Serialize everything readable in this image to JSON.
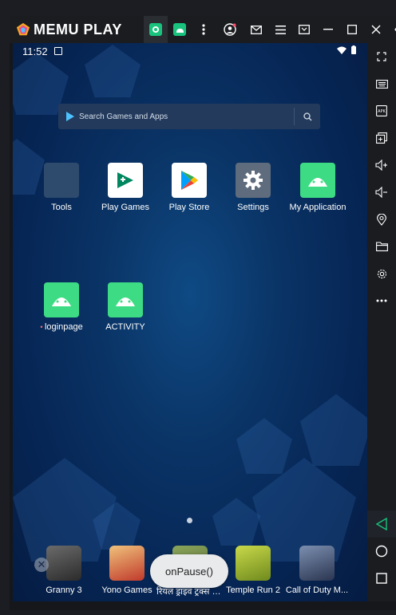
{
  "emulator": {
    "brand": "MEMU PLAY",
    "colors": {
      "accent": "#19c37d",
      "toolbar": "#1a1c20"
    },
    "top_icons": [
      "record-icon",
      "android-icon",
      "more-vert-icon",
      "account-icon",
      "mail-icon",
      "menu-icon",
      "screen-cast-icon",
      "minimize-icon",
      "maximize-icon",
      "close-icon",
      "collapse-icon"
    ],
    "side_icons": [
      "fullscreen-icon",
      "keyboard-icon",
      "apk-icon",
      "multi-window-icon",
      "volume-up-icon",
      "volume-down-icon",
      "location-icon",
      "folder-icon",
      "settings-icon",
      "more-horiz-icon"
    ],
    "nav_icons": [
      "back-icon",
      "home-icon",
      "recents-icon"
    ]
  },
  "status": {
    "time": "11:52"
  },
  "search": {
    "placeholder": "Search Games and Apps"
  },
  "apps": [
    {
      "label": "Tools"
    },
    {
      "label": "Play Games"
    },
    {
      "label": "Play Store"
    },
    {
      "label": "Settings"
    },
    {
      "label": "My Application"
    },
    {
      "label": "loginpage"
    },
    {
      "label": "ACTIVITY"
    }
  ],
  "dock": [
    {
      "label": "Granny 3"
    },
    {
      "label": "Yono Games"
    },
    {
      "label": "रियल ड्राइव ट्रक्स सिम्युलेटर..."
    },
    {
      "label": "Temple Run 2"
    },
    {
      "label": "Call of Duty M..."
    }
  ],
  "toast": {
    "text": "onPause()"
  }
}
